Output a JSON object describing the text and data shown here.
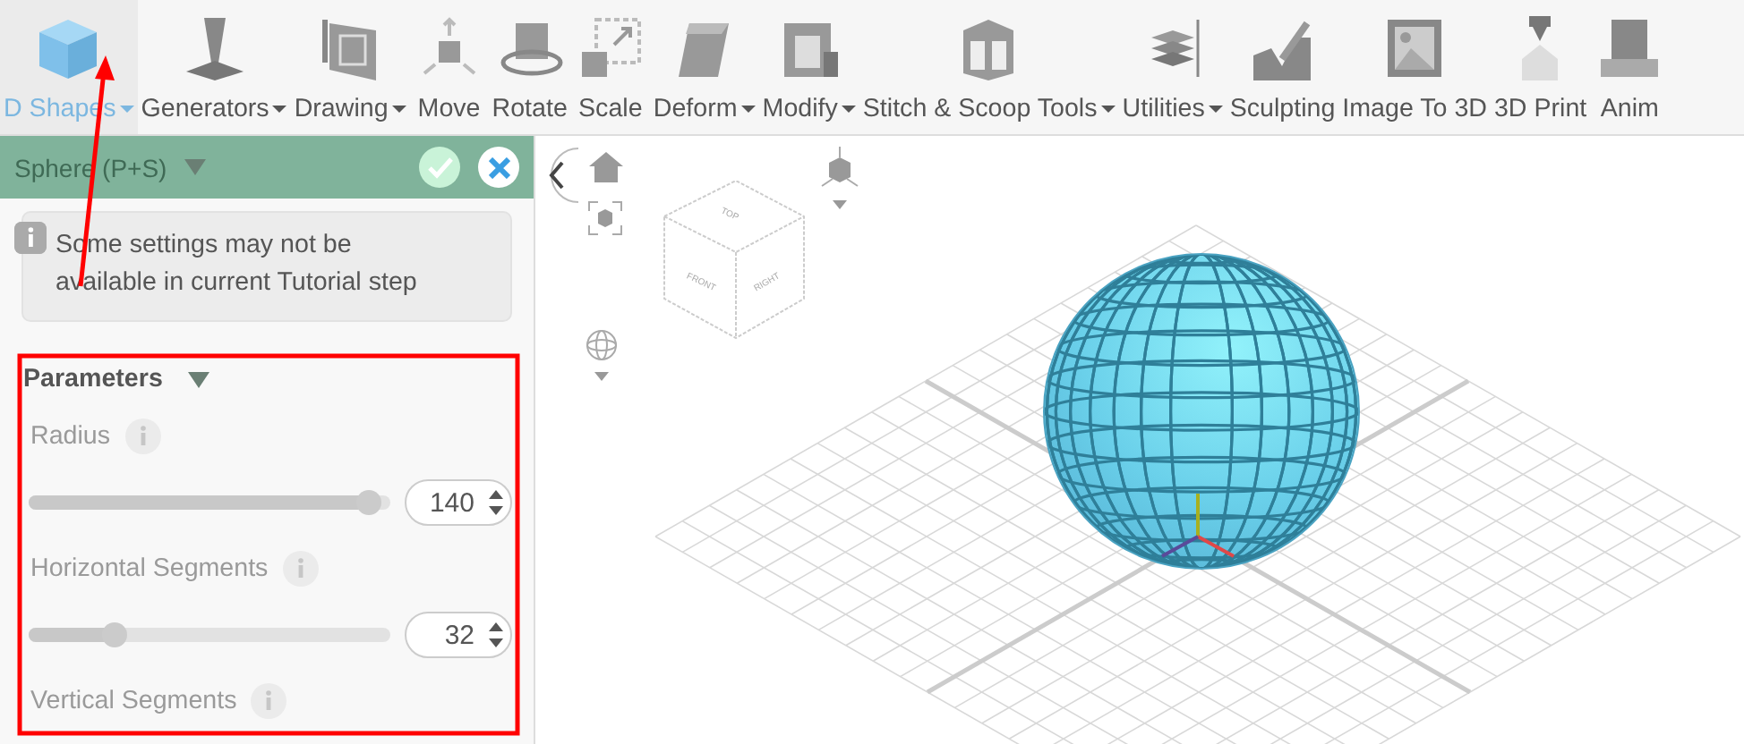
{
  "toolbar": [
    {
      "label": "D Shapes",
      "dropdown": true,
      "selected": true
    },
    {
      "label": "Generators",
      "dropdown": true,
      "selected": false
    },
    {
      "label": "Drawing",
      "dropdown": true,
      "selected": false
    },
    {
      "label": "Move",
      "dropdown": false,
      "selected": false
    },
    {
      "label": "Rotate",
      "dropdown": false,
      "selected": false
    },
    {
      "label": "Scale",
      "dropdown": false,
      "selected": false
    },
    {
      "label": "Deform",
      "dropdown": true,
      "selected": false
    },
    {
      "label": "Modify",
      "dropdown": true,
      "selected": false
    },
    {
      "label": "Stitch & Scoop Tools",
      "dropdown": true,
      "selected": false
    },
    {
      "label": "Utilities",
      "dropdown": true,
      "selected": false
    },
    {
      "label": "Sculpting",
      "dropdown": false,
      "selected": false
    },
    {
      "label": "Image To 3D",
      "dropdown": false,
      "selected": false
    },
    {
      "label": "3D Print",
      "dropdown": false,
      "selected": false
    },
    {
      "label": "Anim",
      "dropdown": false,
      "selected": false
    }
  ],
  "panel": {
    "title": "Sphere (P+S)",
    "notice": "Some settings may not be available in current Tutorial step",
    "section": "Parameters",
    "params": [
      {
        "label": "Radius",
        "disabled": true,
        "level": 0.94,
        "value": "140"
      },
      {
        "label": "Horizontal Segments",
        "disabled": true,
        "level": 0.24,
        "value": "32"
      },
      {
        "label": "Vertical Segments",
        "disabled": true
      }
    ]
  },
  "view_cube": {
    "faces": [
      "TOP",
      "FRONT",
      "RIGHT"
    ]
  }
}
